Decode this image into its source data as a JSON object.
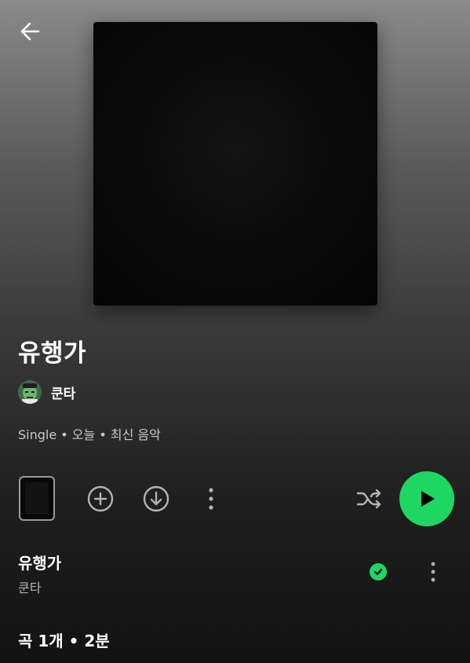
{
  "header": {
    "back_icon": "arrow-left-icon"
  },
  "album": {
    "title": "유행가",
    "artist": "쿤타",
    "meta": "Single • 오늘 • 최신 음악"
  },
  "actions": {
    "add_icon": "plus-circle-icon",
    "download_icon": "download-circle-icon",
    "more_icon": "more-vertical-icon",
    "shuffle_icon": "shuffle-icon",
    "play_icon": "play-icon"
  },
  "tracks": [
    {
      "title": "유행가",
      "artist": "쿤타",
      "downloaded_icon": "check-circle-icon",
      "more_icon": "more-vertical-icon"
    }
  ],
  "summary": "곡 1개 • 2분",
  "colors": {
    "accent": "#1ed760",
    "background": "#121212",
    "secondary_text": "#b3b3b3"
  }
}
